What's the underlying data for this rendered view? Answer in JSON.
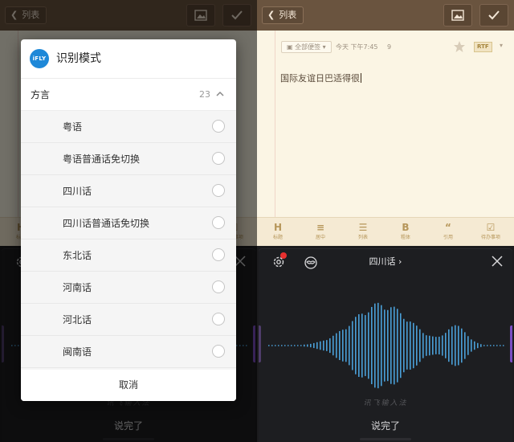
{
  "note_app": {
    "back_label": "列表",
    "tag_label": "全部便签",
    "date_label": "今天 下午7:45",
    "char_count": "9",
    "format_badge": "RTF",
    "body_text": "国际友谊日巴适得很",
    "format_bar": [
      {
        "icon": "H",
        "label": "标题"
      },
      {
        "icon": "≡",
        "label": "居中"
      },
      {
        "icon": "☰",
        "label": "列表"
      },
      {
        "icon": "B",
        "label": "粗体"
      },
      {
        "icon": "“",
        "label": "引用"
      },
      {
        "icon": "☑",
        "label": "待办事项"
      }
    ]
  },
  "voice_panel": {
    "dialect_label": "四川话",
    "brand": "讯飞输入法",
    "done_label": "说完了"
  },
  "dialog": {
    "logo_text": "iFLY",
    "title": "识别模式",
    "section_label": "方言",
    "section_count": "23",
    "options": [
      "粤语",
      "粤语普通话免切换",
      "四川话",
      "四川话普通话免切换",
      "东北话",
      "河南话",
      "河北话",
      "闽南语"
    ],
    "cancel_label": "取消"
  },
  "colors": {
    "topbar": "#6a543f",
    "paper": "#fbf5e4",
    "wave": "#4a9fd8",
    "accent_red": "#e8302f",
    "logo_blue": "#1e88d8"
  }
}
